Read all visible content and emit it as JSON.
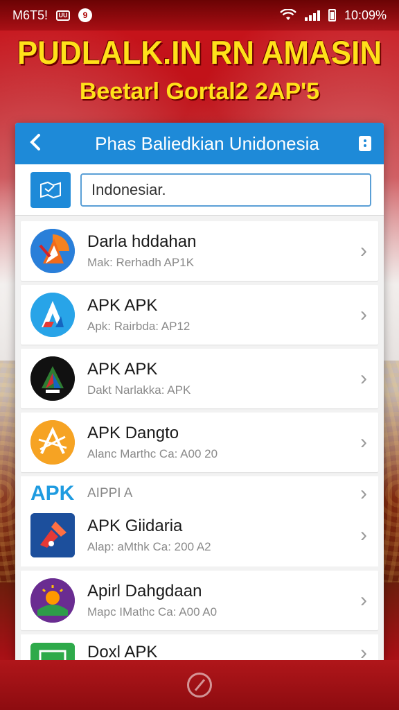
{
  "status_bar": {
    "carrier": "M6T5!",
    "badge": "UU",
    "circle_badge": "9",
    "time": "10:09%"
  },
  "promo": {
    "headline": "PUDLALK.IN RN AMASIN",
    "subheadline": "Beetarl Gortal2 2AP'5"
  },
  "app_bar": {
    "title": "Phas Baliedkian Unidonesia",
    "back_icon": "chevron-left-icon",
    "menu_icon": "more-icon"
  },
  "search": {
    "value": "Indonesiar.",
    "icon": "map-icon"
  },
  "items": [
    {
      "title": "Darla hddahan",
      "subtitle": "Mak: Rerhadh AP1K"
    },
    {
      "title": "APK APK",
      "subtitle": "Apk: Rairbda: AP12"
    },
    {
      "title": "APK APK",
      "subtitle": "Dakt Narlakka: APK"
    },
    {
      "title": "APK Dangto",
      "subtitle": "Alanc Marthc Ca: A00 20"
    }
  ],
  "group": {
    "logo": "APK",
    "label": "AIPPI A",
    "item": {
      "title": "APK Giidaria",
      "subtitle": "Alap: aMthk Ca: 200 A2"
    }
  },
  "items_after": [
    {
      "title": "Apirl Dahgdaan",
      "subtitle": "Mapc IMathc Ca: A00 A0"
    }
  ],
  "last_item": {
    "title": "Doxl APK"
  },
  "colors": {
    "app_bar": "#1e8ad8",
    "promo_text": "#ffe11a",
    "background_red": "#c8141b"
  }
}
